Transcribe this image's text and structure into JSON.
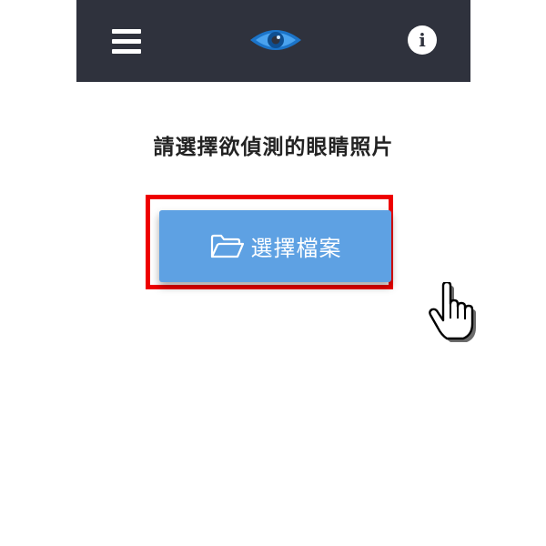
{
  "header": {
    "menu_icon": "hamburger-menu-icon",
    "logo_icon": "eye-logo-icon",
    "info_label": "i",
    "info_icon": "info-icon",
    "background_color": "#2f323d"
  },
  "main": {
    "prompt": "請選擇欲偵測的眼睛照片",
    "choose_button": {
      "label": "選擇檔案",
      "icon": "folder-open-icon",
      "color": "#5ea1e3"
    },
    "highlight_color": "#ee0000",
    "pointer_icon": "hand-pointer-cursor-icon"
  }
}
